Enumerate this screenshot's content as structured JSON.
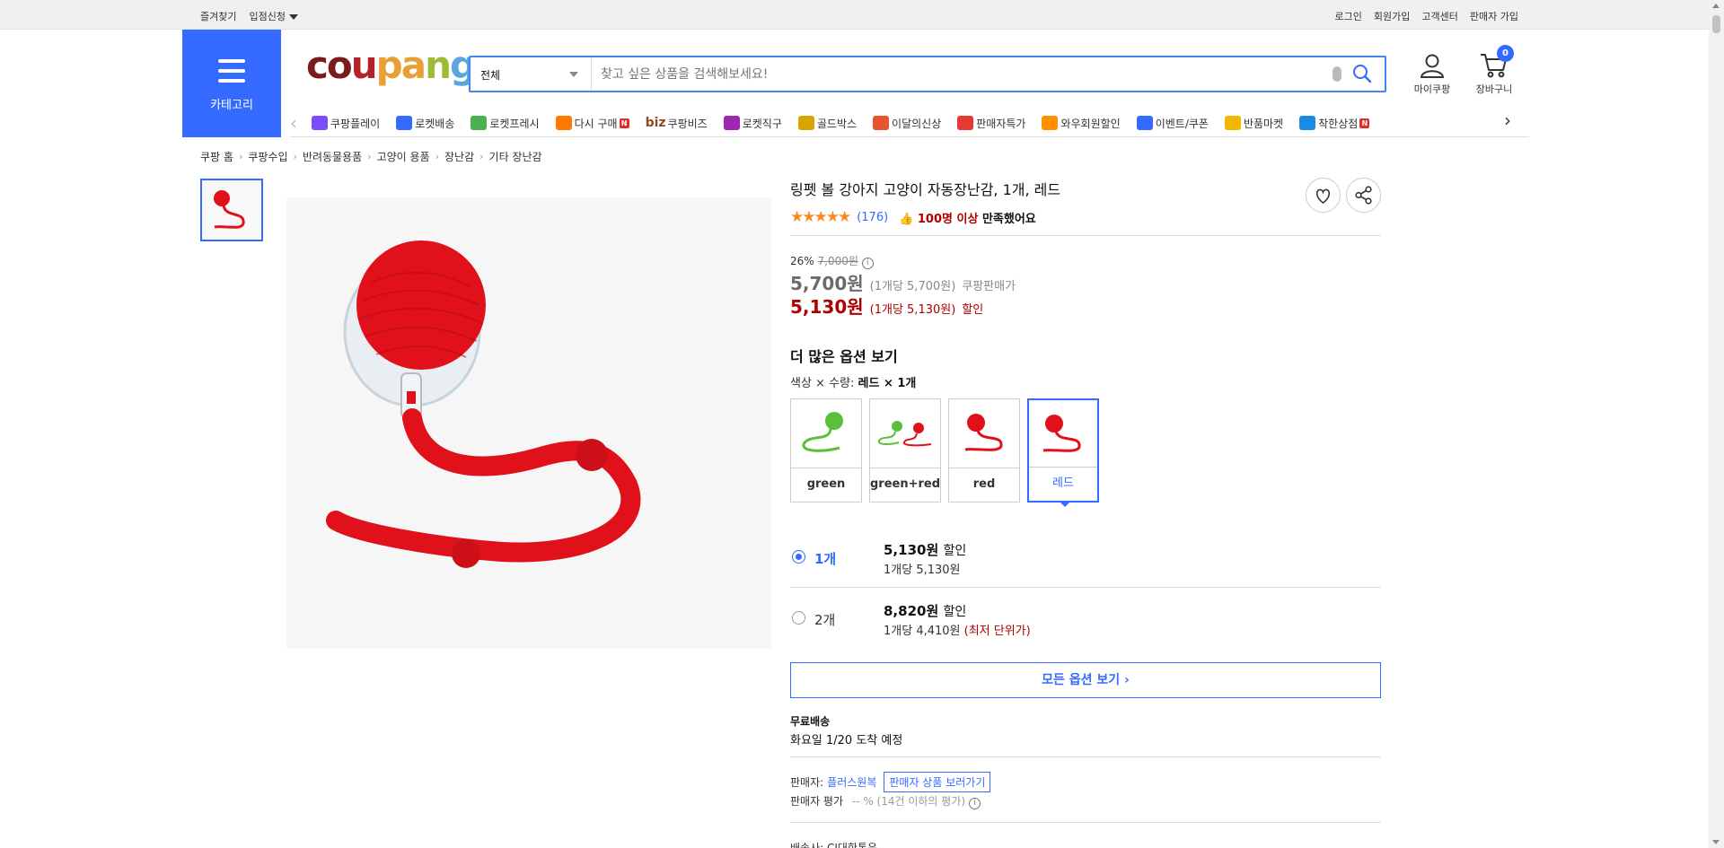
{
  "topbar": {
    "left": [
      "즐겨찾기",
      "입점신청"
    ],
    "right": [
      "로그인",
      "회원가입",
      "고객센터",
      "판매자 가입"
    ]
  },
  "header": {
    "category_label": "카테고리",
    "logo": {
      "c1": "co",
      "c2": "u",
      "c3": "pa",
      "c4": "n",
      "c5": "g"
    },
    "search": {
      "scope": "전체",
      "placeholder": "찾고 싶은 상품을 검색해보세요!"
    },
    "my_label": "마이쿠팡",
    "cart_label": "장바구니",
    "cart_count": "0"
  },
  "nav": [
    {
      "label": "쿠팡플레이",
      "color": "#7c4dff"
    },
    {
      "label": "로켓배송",
      "color": "#346aff"
    },
    {
      "label": "로켓프레시",
      "color": "#4caf50"
    },
    {
      "label": "다시 구매",
      "color": "#ff7a00",
      "badge": "N"
    },
    {
      "label": "쿠팡비즈",
      "color": "#8a4b1f",
      "prefix": "biz"
    },
    {
      "label": "로켓직구",
      "color": "#9c27b0"
    },
    {
      "label": "골드박스",
      "color": "#d9a300"
    },
    {
      "label": "이달의신상",
      "color": "#e8542f"
    },
    {
      "label": "판매자특가",
      "color": "#e53935"
    },
    {
      "label": "와우회원할인",
      "color": "#ff8f00"
    },
    {
      "label": "이벤트/쿠폰",
      "color": "#346aff"
    },
    {
      "label": "반품마켓",
      "color": "#f2b600"
    },
    {
      "label": "착한상점",
      "color": "#1e88e5",
      "badge": "N"
    }
  ],
  "breadcrumb": [
    "쿠팡 홈",
    "쿠팡수입",
    "반려동물용품",
    "고양이 용품",
    "장난감",
    "기타 장난감"
  ],
  "product": {
    "title": "링펫 볼 강아지 고양이 자동장난감, 1개, 레드",
    "stars": "★★★★★",
    "rating_value": 4.5,
    "review_count": "(176)",
    "satisfaction_hi": "100명 이상",
    "satisfaction_rest": " 만족했어요",
    "discount_rate": "26%",
    "original_price": "7,000원",
    "price": "5,700원",
    "price_unit": "(1개당 5,700원)",
    "price_tag": "쿠팡판매가",
    "sale_price": "5,130원",
    "sale_unit": "(1개당 5,130원)",
    "sale_tag": "할인"
  },
  "options": {
    "title": "더 많은 옵션 보기",
    "selected_prefix": "색상 × 수량: ",
    "selected_value": "레드 × 1개",
    "swatches": [
      {
        "label": "green",
        "color": "#5bbf3a"
      },
      {
        "label": "green+red",
        "color": "#5bbf3a"
      },
      {
        "label": "red",
        "color": "#e0111b"
      },
      {
        "label": "레드",
        "color": "#e0111b"
      }
    ],
    "quantities": [
      {
        "label": "1개",
        "price": "5,130원",
        "tag": "할인",
        "unit": "1개당 5,130원",
        "extra": ""
      },
      {
        "label": "2개",
        "price": "8,820원",
        "tag": "할인",
        "unit": "1개당 4,410원",
        "extra": "(최저 단위가)"
      }
    ],
    "all_button": "모든 옵션 보기 ›"
  },
  "shipping": {
    "title": "무료배송",
    "eta": "화요일 1/20 도착 예정"
  },
  "seller": {
    "label": "판매자:",
    "name": "플러스원복",
    "link": "판매자 상품 보러가기",
    "score_label": "판매자 평가",
    "score_value": "-- % (14건 이하의 평가)"
  },
  "cut_text": "배송사: CJ대한통운"
}
